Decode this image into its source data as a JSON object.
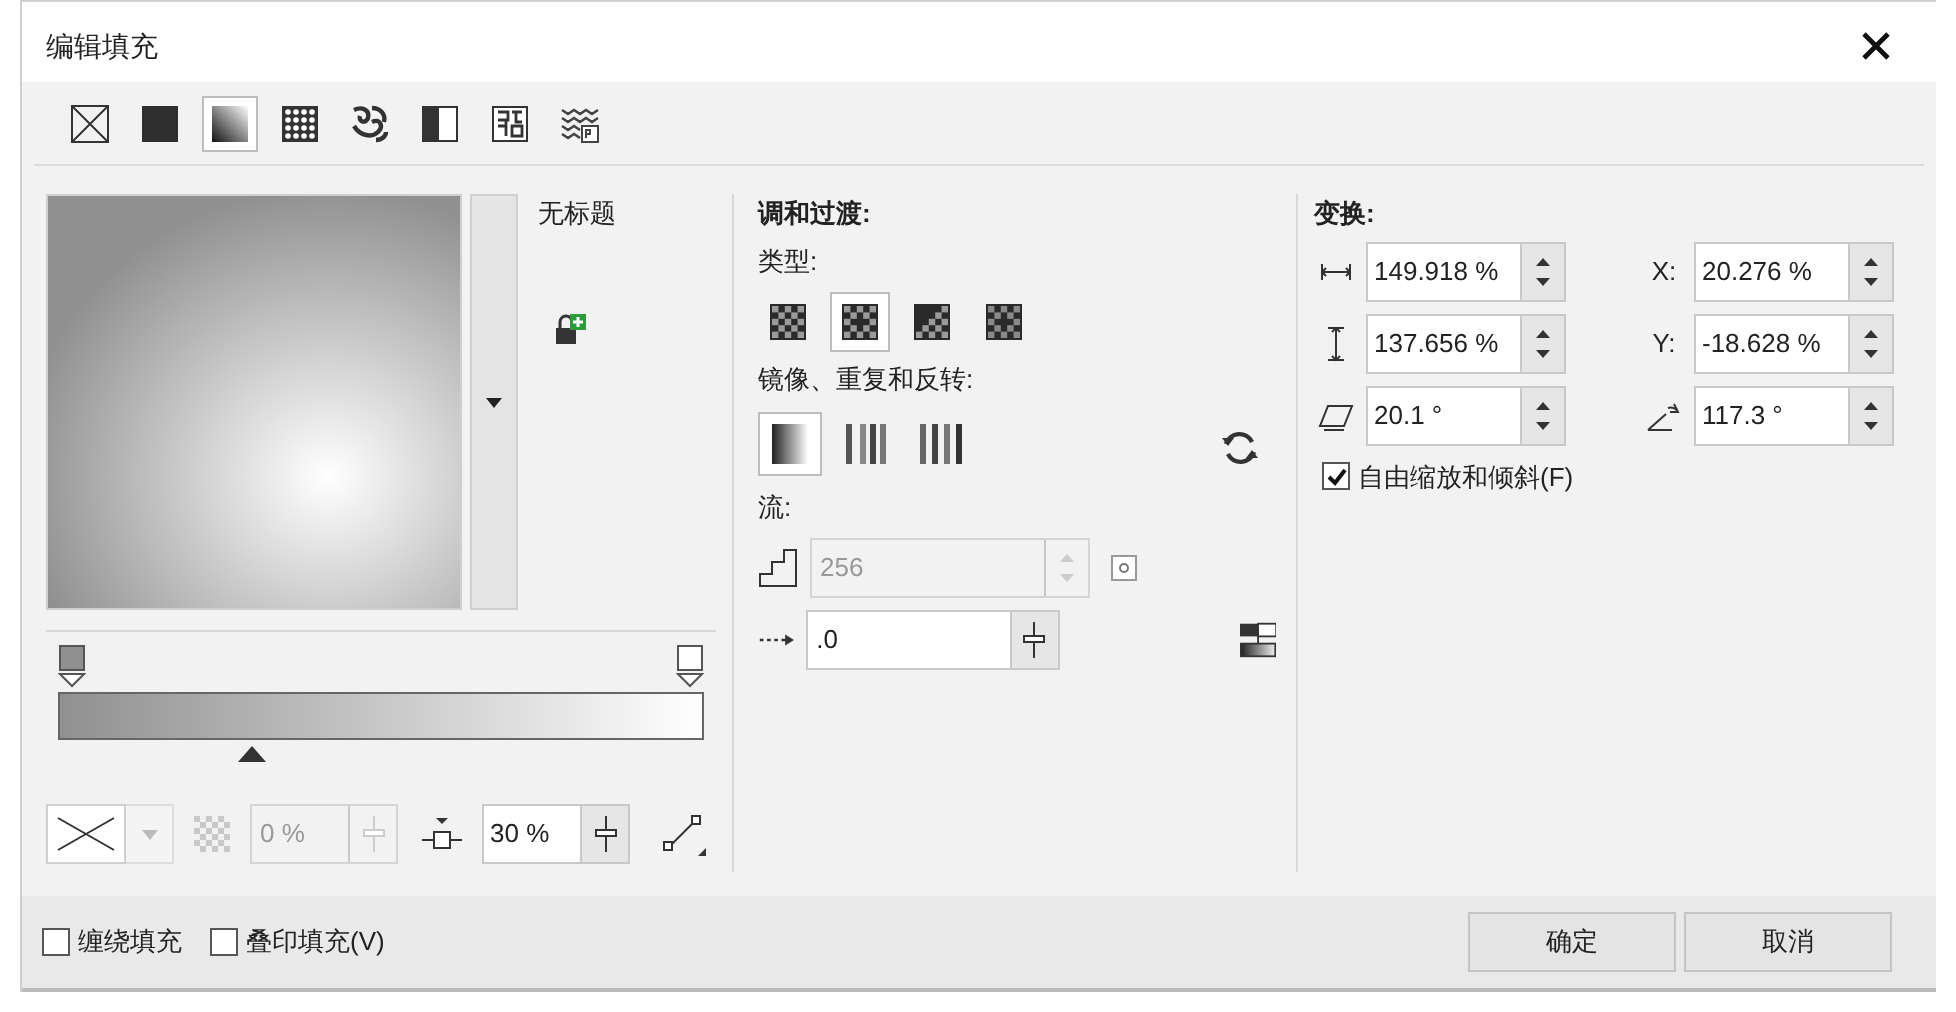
{
  "window": {
    "title": "编辑填充"
  },
  "fill_types": [
    {
      "kind": "none",
      "selected": false
    },
    {
      "kind": "uniform",
      "selected": false
    },
    {
      "kind": "fountain",
      "selected": true
    },
    {
      "kind": "vector",
      "selected": false
    },
    {
      "kind": "bitmap",
      "selected": false
    },
    {
      "kind": "two_color",
      "selected": false
    },
    {
      "kind": "pattern",
      "selected": false
    },
    {
      "kind": "postscript",
      "selected": false
    }
  ],
  "preview": {
    "name": "无标题"
  },
  "gradient": {
    "stops": [
      {
        "color": "#909090"
      },
      {
        "color": "#ffffff"
      }
    ],
    "midpoint": {
      "level": 0.3
    }
  },
  "node_controls": {
    "transparency": {
      "value": "0 %",
      "disabled": true
    },
    "midpoint": {
      "value": "30 %"
    }
  },
  "blend": {
    "title": "调和过渡:",
    "type_label": "类型:",
    "types": [
      {
        "kind": "linear",
        "selected": false
      },
      {
        "kind": "elliptical",
        "selected": true
      },
      {
        "kind": "conical",
        "selected": false
      },
      {
        "kind": "rectangular",
        "selected": false
      }
    ],
    "mirror_label": "镜像、重复和反转:",
    "mirror": [
      {
        "kind": "default",
        "selected": true
      },
      {
        "kind": "mirror",
        "selected": false
      },
      {
        "kind": "repeat",
        "selected": false
      }
    ],
    "flow_label": "流:",
    "steps": {
      "value": "256",
      "disabled": true
    },
    "acceleration": {
      "value": ".0"
    }
  },
  "transform": {
    "title": "变换:",
    "fields": [
      {
        "kind": "width",
        "value": "149.918 %"
      },
      {
        "kind": "x",
        "label": "X:",
        "value": "20.276 %"
      },
      {
        "kind": "height",
        "value": "137.656 %"
      },
      {
        "kind": "y",
        "label": "Y:",
        "value": "-18.628 %"
      },
      {
        "kind": "skew",
        "value": "20.1 °"
      },
      {
        "kind": "rotate",
        "value": "117.3 °"
      }
    ],
    "free_scale": {
      "label": "自由缩放和倾斜(F)",
      "checked": true
    }
  },
  "footer": {
    "options": [
      {
        "label": "缠绕填充",
        "checked": false
      },
      {
        "label": "叠印填充(V)",
        "checked": false
      }
    ],
    "buttons": [
      "确定",
      "取消"
    ]
  }
}
